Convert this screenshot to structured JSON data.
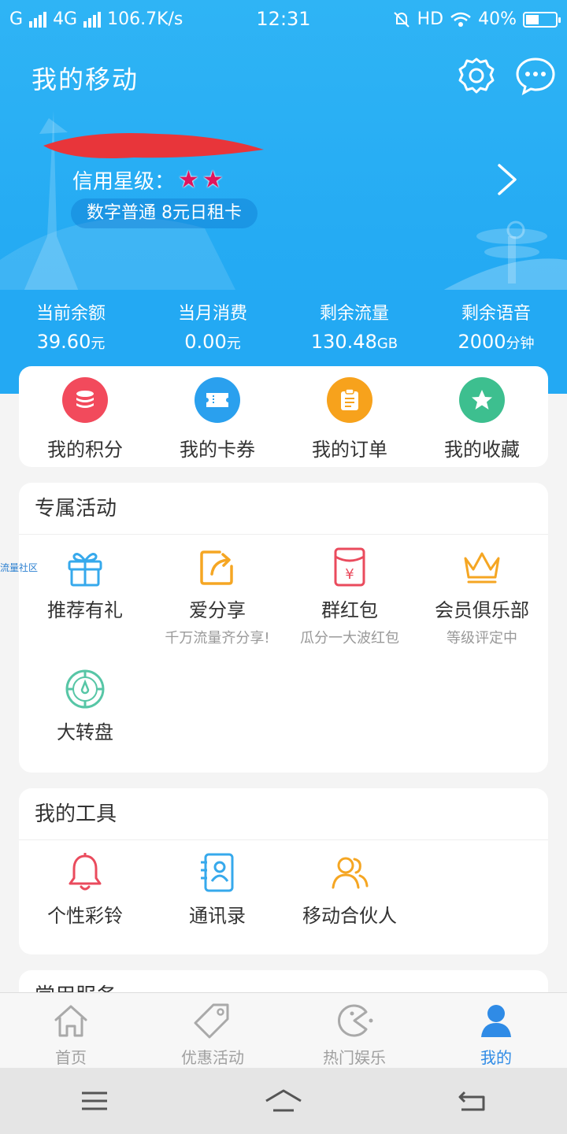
{
  "status_bar": {
    "carrier1": "G",
    "carrier2": "4G",
    "speed": "106.7K/s",
    "time": "12:31",
    "hd": "HD",
    "battery": "40%"
  },
  "header": {
    "title": "我的移动",
    "settings_icon": "settings-icon",
    "message_icon": "message-icon"
  },
  "profile": {
    "credit_label": "信用星级：",
    "credit_stars": 2,
    "plan": "数字普通  8元日租卡"
  },
  "stats": [
    {
      "label": "当前余额",
      "value": "39.60",
      "unit": "元"
    },
    {
      "label": "当月消费",
      "value": "0.00",
      "unit": "元"
    },
    {
      "label": "剩余流量",
      "value": "130.48",
      "unit": "GB"
    },
    {
      "label": "剩余语音",
      "value": "2000",
      "unit": "分钟"
    }
  ],
  "quick_links": [
    {
      "label": "我的积分",
      "icon": "coins-icon",
      "color": "#f24a5c"
    },
    {
      "label": "我的卡券",
      "icon": "ticket-icon",
      "color": "#2aa0ee"
    },
    {
      "label": "我的订单",
      "icon": "order-icon",
      "color": "#f7a21c"
    },
    {
      "label": "我的收藏",
      "icon": "star-icon",
      "color": "#3dbf8f"
    }
  ],
  "activities": {
    "title": "专属活动",
    "items": [
      {
        "label": "推荐有礼",
        "sub": "",
        "icon": "gift-icon"
      },
      {
        "label": "爱分享",
        "sub": "千万流量齐分享!",
        "icon": "share-icon"
      },
      {
        "label": "群红包",
        "sub": "瓜分一大波红包",
        "icon": "red-packet-icon"
      },
      {
        "label": "会员俱乐部",
        "sub": "等级评定中",
        "icon": "crown-icon"
      },
      {
        "label": "大转盘",
        "sub": "",
        "icon": "wheel-icon"
      }
    ]
  },
  "tools": {
    "title": "我的工具",
    "items": [
      {
        "label": "个性彩铃",
        "icon": "bell-icon"
      },
      {
        "label": "通讯录",
        "icon": "contacts-icon"
      },
      {
        "label": "移动合伙人",
        "icon": "partners-icon"
      }
    ]
  },
  "services": {
    "title": "常用服务"
  },
  "side_float": "流量社区",
  "tabbar": [
    {
      "label": "首页",
      "icon": "home-icon",
      "active": false
    },
    {
      "label": "优惠活动",
      "icon": "tag-icon",
      "active": false
    },
    {
      "label": "热门娱乐",
      "icon": "game-icon",
      "active": false
    },
    {
      "label": "我的",
      "icon": "user-icon",
      "active": true
    }
  ],
  "system_nav": [
    "menu-icon",
    "home-button-icon",
    "back-icon"
  ]
}
